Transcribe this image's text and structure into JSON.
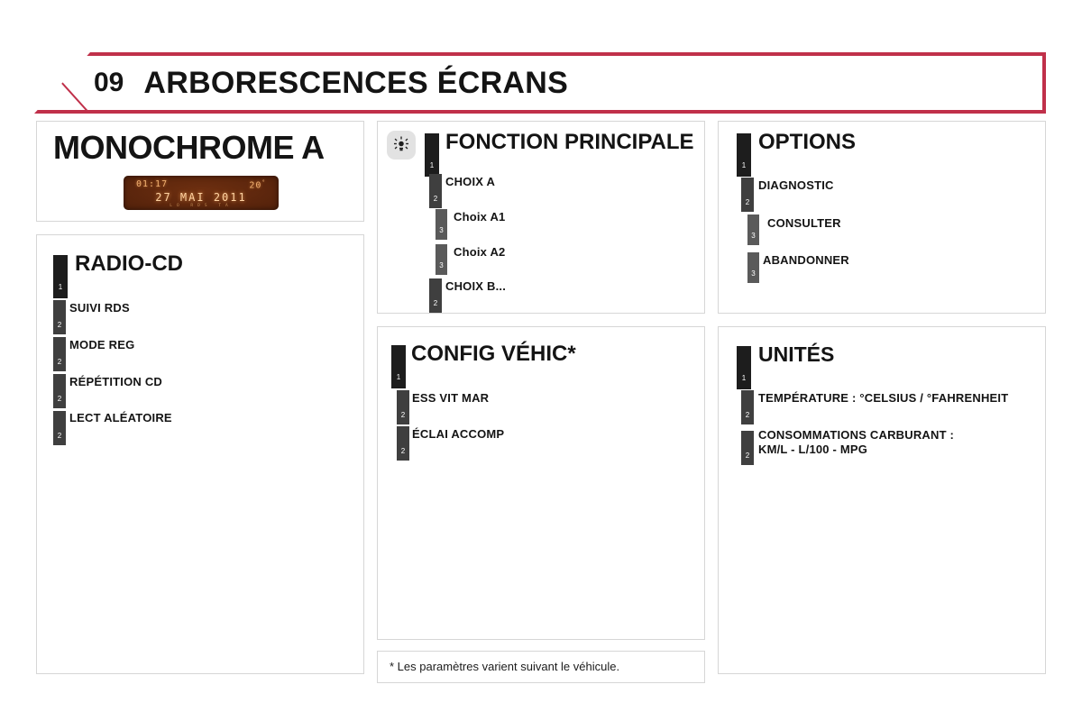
{
  "header": {
    "number": "09",
    "title": "ARBORESCENCES ÉCRANS",
    "accent_color": "#c0304a"
  },
  "monochrome": {
    "title": "MONOCHROME A",
    "display": {
      "time": "01:17",
      "temperature": "20",
      "temperature_unit": "°",
      "date": "27 MAI 2011",
      "sub": "LO   RDS   TA",
      "screen_color": "#58240c",
      "text_color": "#f0b070"
    }
  },
  "radio_cd": {
    "title": "RADIO-CD",
    "title_level": "1",
    "items": [
      {
        "label": "SUIVI RDS",
        "level": "2"
      },
      {
        "label": "MODE REG",
        "level": "2"
      },
      {
        "label": "RÉPÉTITION CD",
        "level": "2"
      },
      {
        "label": "LECT ALÉATOIRE",
        "level": "2"
      }
    ]
  },
  "fonction_principale": {
    "icon": "brightness-sun-icon",
    "title": "FONCTION PRINCIPALE",
    "title_level": "1",
    "items": [
      {
        "label": "CHOIX A",
        "level": "2"
      },
      {
        "label": "Choix A1",
        "level": "3"
      },
      {
        "label": "Choix A2",
        "level": "3"
      },
      {
        "label": "CHOIX B...",
        "level": "2"
      }
    ]
  },
  "config_vehic": {
    "title": "CONFIG VÉHIC*",
    "title_level": "1",
    "items": [
      {
        "label": "ESS VIT MAR",
        "level": "2"
      },
      {
        "label": "ÉCLAI ACCOMP",
        "level": "2"
      }
    ]
  },
  "footnote": {
    "text": "* Les paramètres varient suivant le véhicule."
  },
  "options": {
    "title": "OPTIONS",
    "title_level": "1",
    "items": [
      {
        "label": "DIAGNOSTIC",
        "level": "2"
      },
      {
        "label": "CONSULTER",
        "level": "3"
      },
      {
        "label": "ABANDONNER",
        "level": "3"
      }
    ]
  },
  "unites": {
    "title": "UNITÉS",
    "title_level": "1",
    "items": [
      {
        "label": "TEMPÉRATURE : °CELSIUS / °FAHRENHEIT",
        "level": "2"
      },
      {
        "label": "CONSOMMATIONS CARBURANT :\nKM/L - L/100 - MPG",
        "level": "2"
      }
    ]
  }
}
